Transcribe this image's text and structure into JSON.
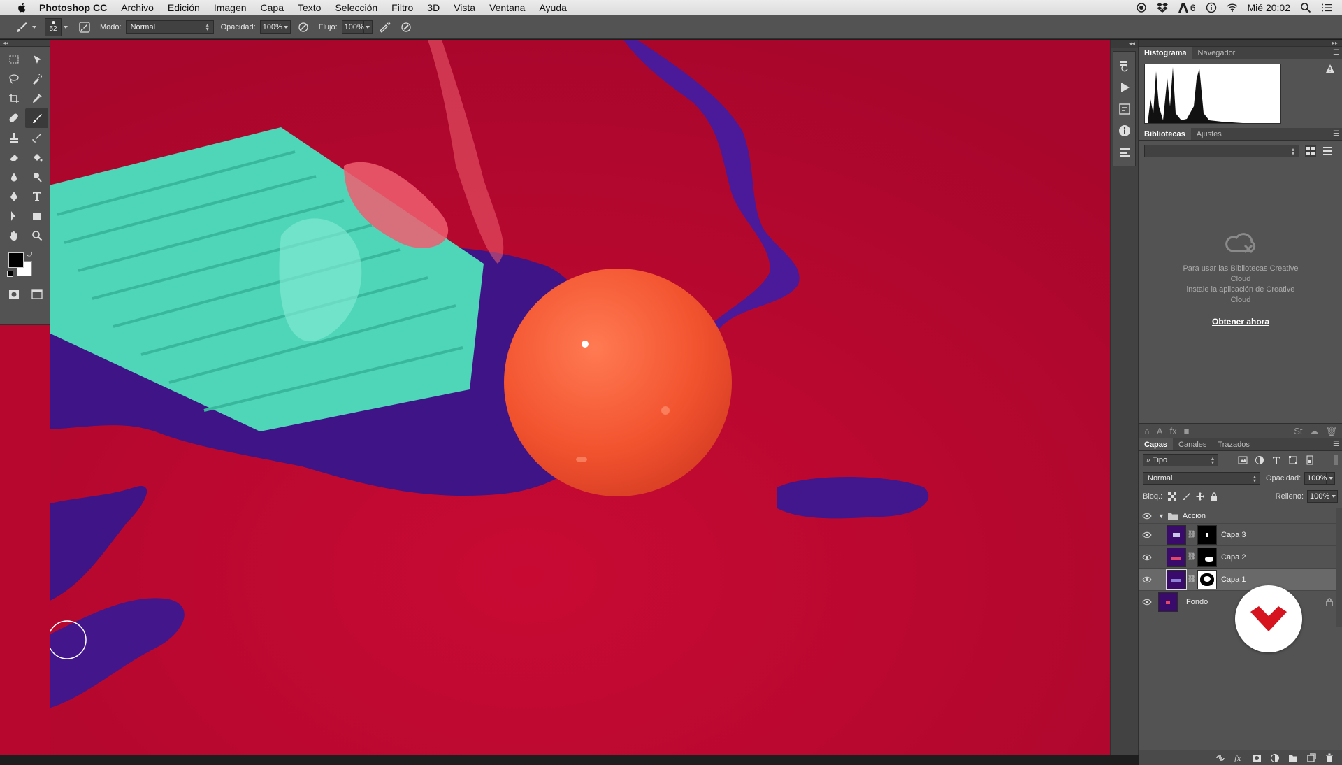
{
  "menubar": {
    "app": "Photoshop CC",
    "menus": [
      "Archivo",
      "Edición",
      "Imagen",
      "Capa",
      "Texto",
      "Selección",
      "Filtro",
      "3D",
      "Vista",
      "Ventana",
      "Ayuda"
    ],
    "status_badge": "6",
    "clock": "Mié 20:02"
  },
  "options": {
    "brush_size": "52",
    "mode_label": "Modo:",
    "mode_value": "Normal",
    "opacity_label": "Opacidad:",
    "opacity_value": "100%",
    "flow_label": "Flujo:",
    "flow_value": "100%"
  },
  "panels": {
    "top_tabs": [
      "Histograma",
      "Navegador"
    ],
    "lib_tabs": [
      "Bibliotecas",
      "Ajustes"
    ],
    "lib_message_1": "Para usar las Bibliotecas Creative",
    "lib_message_2": "Cloud",
    "lib_message_3": "instale la aplicación de Creative",
    "lib_message_4": "Cloud",
    "lib_link": "Obtener ahora",
    "layer_tabs": [
      "Capas",
      "Canales",
      "Trazados"
    ]
  },
  "layers_panel": {
    "kind_filter": "Tipo",
    "blend_mode": "Normal",
    "opacity_label": "Opacidad:",
    "opacity_value": "100%",
    "lock_label": "Bloq.:",
    "fill_label": "Relleno:",
    "fill_value": "100%",
    "layers": [
      {
        "name": "Acción",
        "type": "group"
      },
      {
        "name": "Capa 3",
        "type": "masked"
      },
      {
        "name": "Capa 2",
        "type": "masked"
      },
      {
        "name": "Capa 1",
        "type": "masked",
        "selected": true
      },
      {
        "name": "Fondo",
        "type": "background",
        "locked": true
      }
    ]
  },
  "colors": {
    "canvas_red": "#b8072f",
    "ball_orange": "#f2532f",
    "paint_purple": "#4a1a8c",
    "chalk_teal": "#4fd6b9",
    "watermark_red": "#d5141f"
  }
}
